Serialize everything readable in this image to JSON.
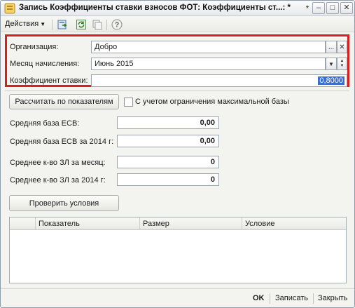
{
  "window": {
    "title": "Запись Коэффициенты ставки взносов ФОТ: Коэффициенты ст...: *",
    "controls": {
      "minimize": "–",
      "restore": "□",
      "close": "✕"
    }
  },
  "toolbar": {
    "actions_label": "Действия",
    "icons": [
      "save-and-copy-icon",
      "refresh-icon",
      "copy-icon",
      "help-icon"
    ],
    "help_symbol": "?"
  },
  "form": {
    "organization": {
      "label": "Организация:",
      "value": "Добро",
      "select_button": "...",
      "clear_button": "✕"
    },
    "month": {
      "label": "Месяц начисления:",
      "value": "Июнь 2015"
    },
    "coefficient": {
      "label": "Коэффициент ставки:",
      "value": "0,8000"
    }
  },
  "calc": {
    "button_label": "Рассчитать по показателям",
    "checkbox_label": "С учетом ограничения максимальной базы",
    "checkbox_checked": false
  },
  "metrics": [
    {
      "label": "Средняя база ЕСВ:",
      "value": "0,00"
    },
    {
      "label": "Средняя база ЕСВ за 2014 г:",
      "value": "0,00"
    },
    {
      "label": "Среднее к-во ЗЛ за месяц:",
      "value": "0"
    },
    {
      "label": "Среднее к-во ЗЛ за 2014 г:",
      "value": "0"
    }
  ],
  "check_button_label": "Проверить условия",
  "table": {
    "columns": [
      "Показатель",
      "Размер",
      "Условие"
    ],
    "rows": []
  },
  "footer": {
    "ok_label": "OK",
    "save_label": "Записать",
    "close_label": "Закрыть"
  },
  "colors": {
    "highlight_border": "#d62020",
    "selection": "#3a6fd0"
  }
}
